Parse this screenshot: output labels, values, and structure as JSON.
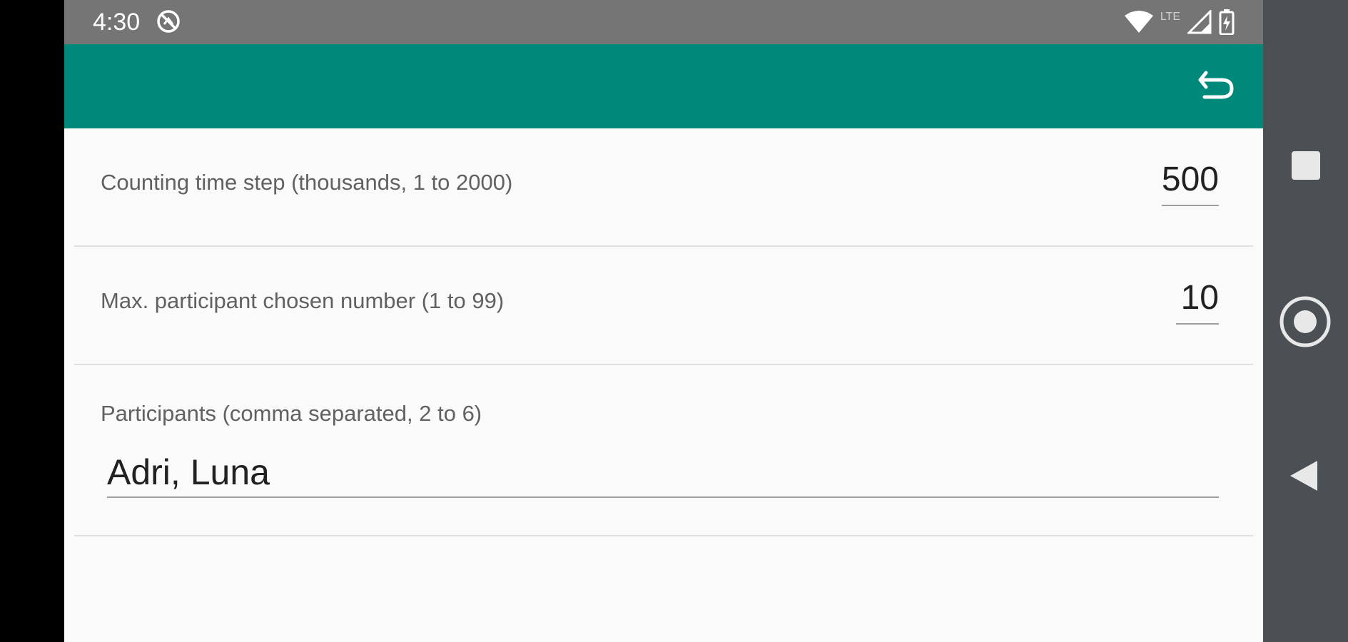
{
  "status_bar": {
    "time": "4:30",
    "network_label": "LTE",
    "dnd_icon": "do-not-disturb-icon",
    "wifi_icon": "wifi-icon",
    "signal_icon": "cell-signal-icon",
    "battery_icon": "battery-charging-icon"
  },
  "toolbar": {
    "color": "#00897b",
    "undo_icon": "undo-icon"
  },
  "settings": {
    "counting_time_step": {
      "label": "Counting time step (thousands, 1 to 2000)",
      "value": "500"
    },
    "max_chosen_number": {
      "label": "Max. participant chosen number (1 to 99)",
      "value": "10"
    },
    "participants": {
      "label": "Participants (comma separated, 2 to 6)",
      "value": "Adri, Luna"
    }
  },
  "nav_bar": {
    "recents_icon": "recents-square-icon",
    "home_icon": "home-circle-icon",
    "back_icon": "back-triangle-icon"
  },
  "colors": {
    "status_bar": "#757575",
    "accent": "#00897b",
    "background": "#fafafa",
    "nav_bar": "#4a5053"
  }
}
